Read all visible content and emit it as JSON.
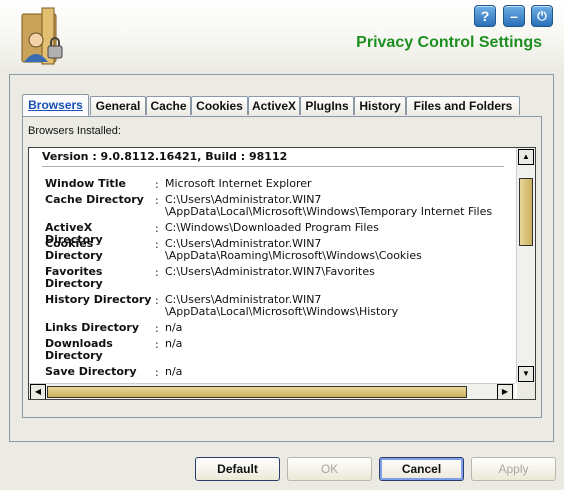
{
  "header": {
    "title": "Privacy Control Settings"
  },
  "window_controls": [
    {
      "icon": "help-icon",
      "glyph": "?"
    },
    {
      "icon": "minimize-icon",
      "glyph": "–"
    },
    {
      "icon": "power-icon",
      "glyph": "⏻"
    }
  ],
  "tabs": [
    {
      "label": "Browsers",
      "active": true
    },
    {
      "label": "General"
    },
    {
      "label": "Cache"
    },
    {
      "label": "Cookies"
    },
    {
      "label": "ActiveX"
    },
    {
      "label": "PlugIns"
    },
    {
      "label": "History"
    },
    {
      "label": "Files and Folders"
    }
  ],
  "browsers": {
    "installed_label": "Browsers Installed:",
    "version_line": "Version : 9.0.8112.16421, Build : 98112",
    "rows": [
      {
        "label": "Window Title",
        "value": "Microsoft Internet Explorer"
      },
      {
        "label": "Cache Directory",
        "value": "C:\\Users\\Administrator.WIN7 \\AppData\\Local\\Microsoft\\Windows\\Temporary Internet Files"
      },
      {
        "label": "ActiveX Directory",
        "value": "C:\\Windows\\Downloaded Program Files"
      },
      {
        "label": "Cookies Directory",
        "value": "C:\\Users\\Administrator.WIN7 \\AppData\\Roaming\\Microsoft\\Windows\\Cookies"
      },
      {
        "label": "Favorites Directory",
        "value": "C:\\Users\\Administrator.WIN7\\Favorites"
      },
      {
        "label": "History Directory",
        "value": "C:\\Users\\Administrator.WIN7 \\AppData\\Local\\Microsoft\\Windows\\History"
      },
      {
        "label": "Links Directory",
        "value": "n/a"
      },
      {
        "label": "Downloads Directory",
        "value": "n/a"
      },
      {
        "label": "Save Directory",
        "value": "n/a"
      }
    ]
  },
  "buttons": {
    "default": "Default",
    "ok": "OK",
    "cancel": "Cancel",
    "apply": "Apply"
  },
  "colors": {
    "title": "#1f8f22",
    "active_tab": "#1a4fb8"
  }
}
